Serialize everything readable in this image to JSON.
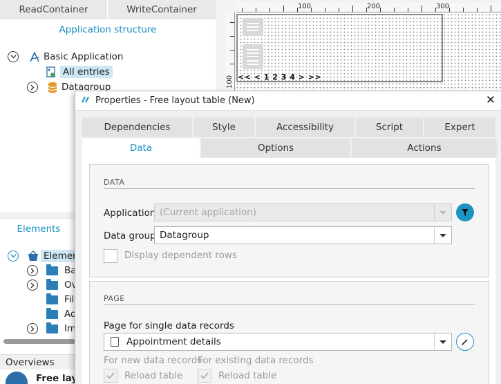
{
  "left_panel": {
    "tabs": [
      "ReadContainer",
      "WriteContainer"
    ],
    "app_structure_title": "Application structure",
    "tree": {
      "root": "Basic Application",
      "all_entries": "All entries",
      "datagroup": "Datagroup"
    },
    "elements_title": "Elements",
    "elements_tree": [
      "Elemen",
      "Ba",
      "Ov",
      "Filt",
      "Ad",
      "Im"
    ],
    "overviews_label": "Overviews",
    "overview_item": "Free layo"
  },
  "designer": {
    "ruler_top": [
      "100",
      "200",
      "300"
    ],
    "ruler_left": [
      "100"
    ],
    "pager": "<< < 1 2 3 4 > >>"
  },
  "dialog": {
    "title": "Properties - Free layout table (New)",
    "tabs_row1": [
      "Dependencies",
      "Style",
      "Accessibility",
      "Script",
      "Expert"
    ],
    "tabs_row2": [
      "Data",
      "Options",
      "Actions"
    ],
    "active_tab": "Data",
    "data_section": {
      "title": "DATA",
      "application_label": "Application",
      "application_value": "(Current application)",
      "datagroup_label": "Data group",
      "datagroup_value": "Datagroup",
      "display_dependent_rows": "Display dependent rows"
    },
    "page_section": {
      "title": "PAGE",
      "single_records_label": "Page for single data records",
      "page_value": "Appointment details",
      "for_new_label": "For new data records",
      "for_existing_label": "For existing data records",
      "reload_new": "Reload table",
      "reload_existing": "Reload table"
    }
  },
  "colors": {
    "accent": "#1a8fbf",
    "folder": "#2b7fb8",
    "tab_inactive": "#e2e2e2"
  }
}
